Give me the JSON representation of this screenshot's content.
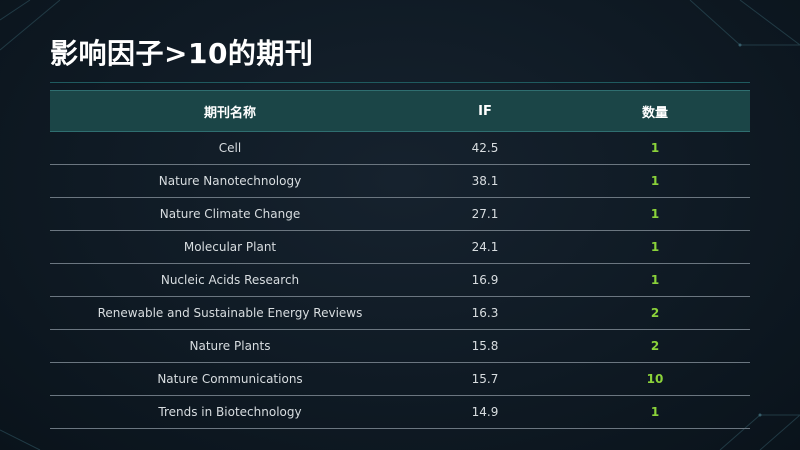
{
  "title": "影响因子>10的期刊",
  "table": {
    "headers": [
      "期刊名称",
      "IF",
      "数量"
    ],
    "rows": [
      {
        "journal": "Cell",
        "if": "42.5",
        "count": "1"
      },
      {
        "journal": "Nature Nanotechnology",
        "if": "38.1",
        "count": "1"
      },
      {
        "journal": "Nature Climate Change",
        "if": "27.1",
        "count": "1"
      },
      {
        "journal": "Molecular Plant",
        "if": "24.1",
        "count": "1"
      },
      {
        "journal": "Nucleic Acids Research",
        "if": "16.9",
        "count": "1"
      },
      {
        "journal": "Renewable and Sustainable Energy Reviews",
        "if": "16.3",
        "count": "2"
      },
      {
        "journal": "Nature Plants",
        "if": "15.8",
        "count": "2"
      },
      {
        "journal": "Nature Communications",
        "if": "15.7",
        "count": "10"
      },
      {
        "journal": "Trends in Biotechnology",
        "if": "14.9",
        "count": "1"
      }
    ]
  },
  "colors": {
    "background": "#0f1a24",
    "header_fill": "#1b4547",
    "count_text": "#8bd33a"
  }
}
